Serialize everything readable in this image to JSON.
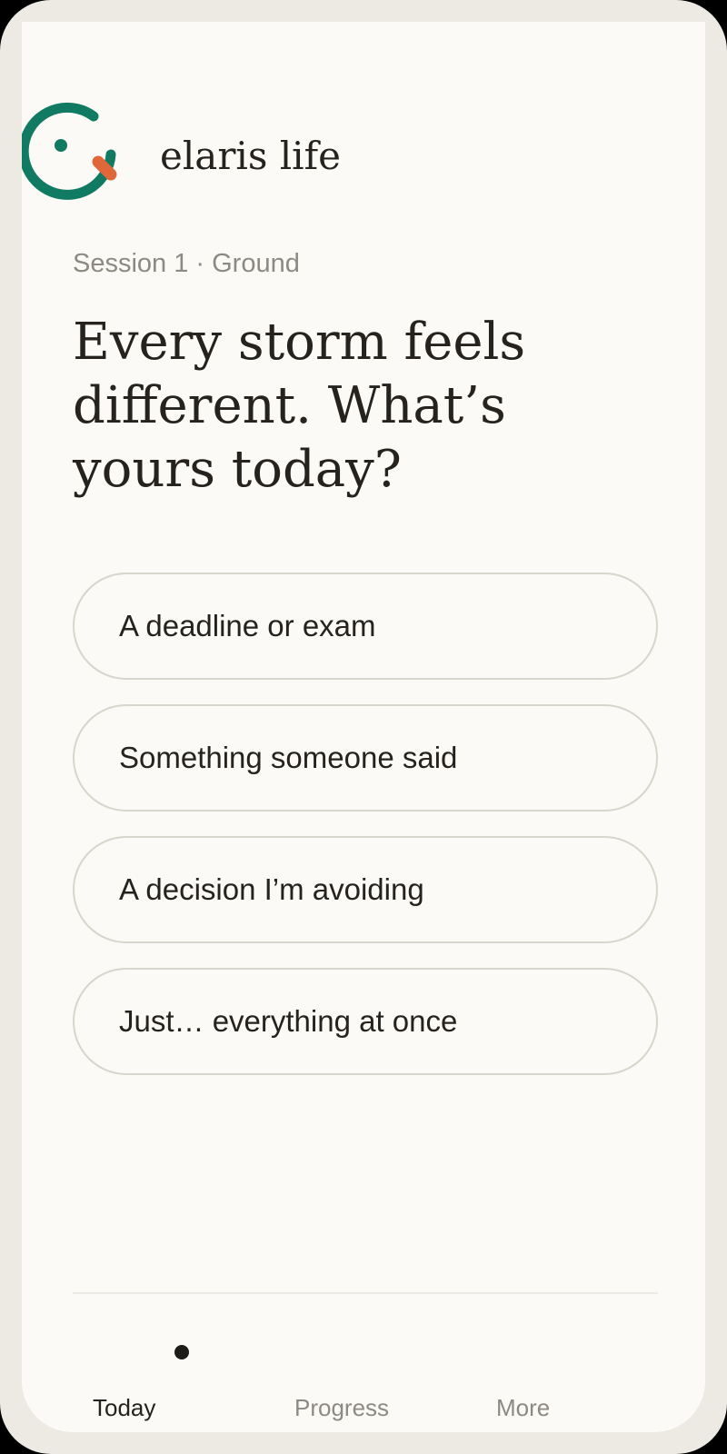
{
  "app": {
    "brand_name": "elaris life",
    "logo_icon": "smile-logo-icon",
    "colors": {
      "logo_primary": "#117a63",
      "logo_accent": "#e0673a",
      "background": "#fbfaf6",
      "text": "#26231f",
      "muted": "#8c8a82"
    }
  },
  "session": {
    "label": "Session 1 · Ground"
  },
  "question": {
    "text": "Every storm feels different. What’s yours today?"
  },
  "options": [
    {
      "label": "A deadline or exam"
    },
    {
      "label": "Something someone said"
    },
    {
      "label": "A decision I’m avoiding"
    },
    {
      "label": "Just… everything at once"
    }
  ],
  "nav": {
    "active": "Today",
    "items": [
      {
        "label": "Today"
      },
      {
        "label": "Progress"
      },
      {
        "label": "More"
      }
    ]
  }
}
